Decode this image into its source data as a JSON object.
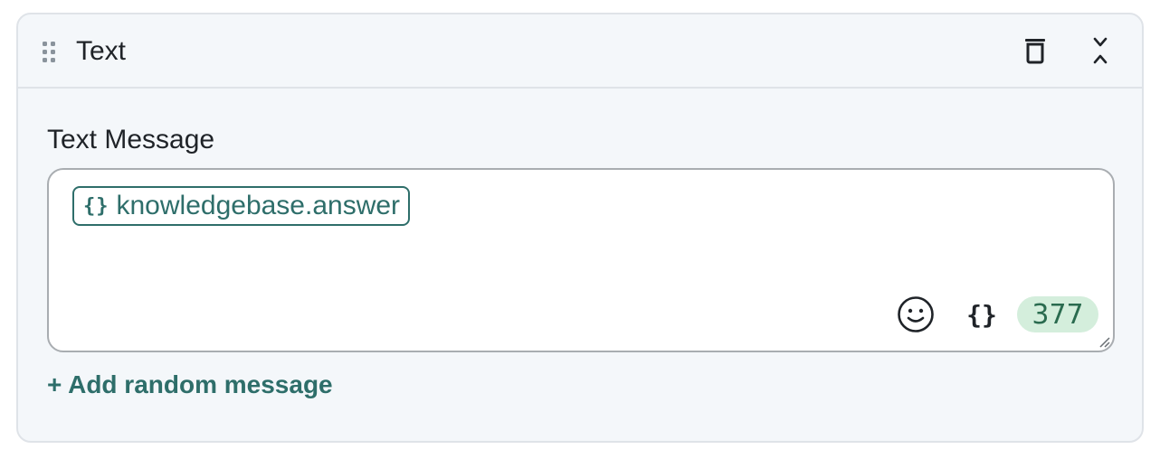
{
  "header": {
    "title": "Text",
    "icons": {
      "drag": "drag-handle-icon",
      "delete": "trash-icon",
      "collapse": "collapse-icon"
    }
  },
  "field": {
    "label": "Text Message",
    "variable_chip": {
      "braces": "{}",
      "text": "knowledgebase.answer"
    },
    "toolbar": {
      "emoji_icon": "smiley-icon",
      "variable_label": "{}",
      "char_count": "377"
    }
  },
  "actions": {
    "add_random_label": "+ Add random message"
  },
  "colors": {
    "accent": "#2e6e6a",
    "card_background": "#f4f7fa",
    "border": "#dfe3e8",
    "count_badge_bg": "#d4eedc"
  }
}
